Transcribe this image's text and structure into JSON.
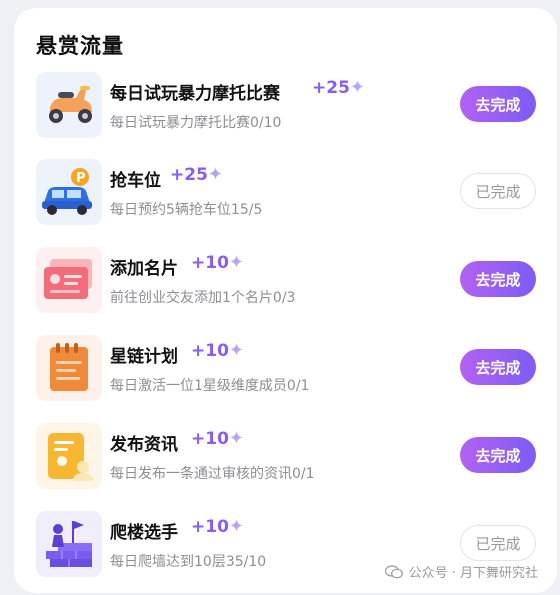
{
  "section": {
    "title": "悬赏流量"
  },
  "tasks": [
    {
      "title": "每日试玩暴力摩托比赛",
      "reward": "+25",
      "desc": "每日试玩暴力摩托比赛0/10",
      "button": "去完成",
      "status": "todo",
      "icon": "scooter-icon"
    },
    {
      "title": "抢车位",
      "reward": "+25",
      "desc": "每日预约5辆抢车位15/5",
      "button": "已完成",
      "status": "done",
      "icon": "parking-car-icon"
    },
    {
      "title": "添加名片",
      "reward": "+10",
      "desc": "前往创业交友添加1个名片0/3",
      "button": "去完成",
      "status": "todo",
      "icon": "business-card-icon"
    },
    {
      "title": "星链计划",
      "reward": "+10",
      "desc": "每日激活一位1星级维度成员0/1",
      "button": "去完成",
      "status": "todo",
      "icon": "notebook-icon"
    },
    {
      "title": "发布资讯",
      "reward": "+10",
      "desc": "每日发布一条通过审核的资讯0/1",
      "button": "去完成",
      "status": "todo",
      "icon": "news-document-icon"
    },
    {
      "title": "爬楼选手",
      "reward": "+10",
      "desc": "每日爬墙达到10层35/10",
      "button": "已完成",
      "status": "done",
      "icon": "climbing-wall-icon"
    }
  ],
  "watermark": {
    "text": "公众号 · 月下舞研究社"
  },
  "colors": {
    "accent": "#8a5cf0",
    "button_gradient_start": "#b362f2",
    "button_gradient_end": "#7d5cf4",
    "muted": "#8e8e93"
  }
}
